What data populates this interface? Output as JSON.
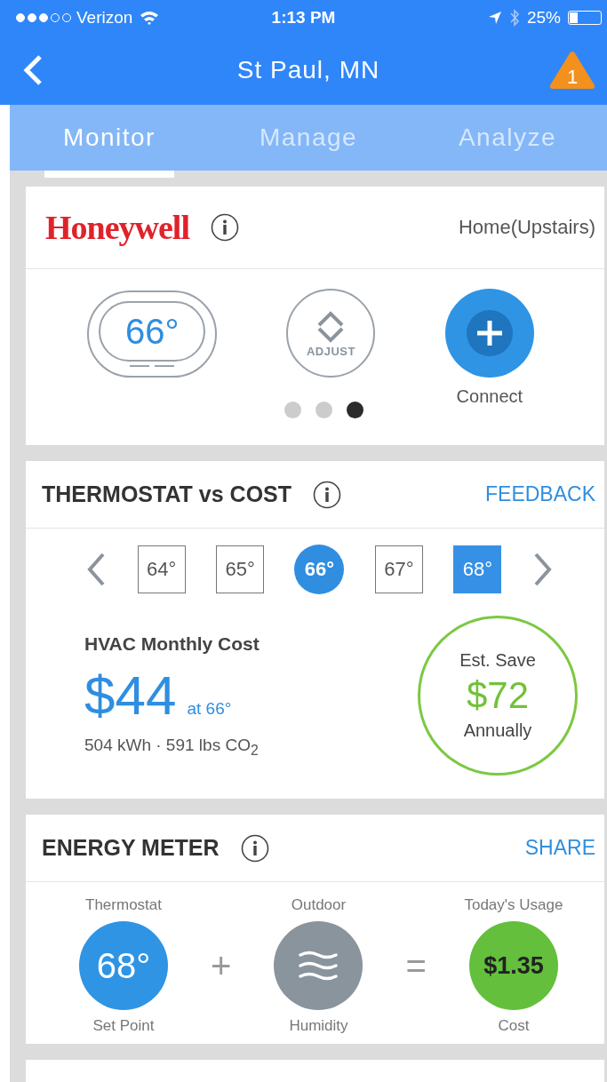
{
  "status_bar": {
    "carrier": "Verizon",
    "time": "1:13 PM",
    "battery": "25%"
  },
  "nav": {
    "title": "St Paul, MN",
    "alert_count": "1"
  },
  "tabs": [
    {
      "label": "Monitor",
      "selected": true
    },
    {
      "label": "Manage",
      "selected": false
    },
    {
      "label": "Analyze",
      "selected": false
    }
  ],
  "device_card": {
    "brand": "Honeywell",
    "location": "Home(Upstairs)",
    "temperature": "66°",
    "adjust_label": "ADJUST",
    "connect_label": "Connect",
    "pages": [
      {
        "selected": false
      },
      {
        "selected": false
      },
      {
        "selected": true
      }
    ]
  },
  "cost_card": {
    "title": "THERMOSTAT vs COST",
    "action": "FEEDBACK",
    "temps": [
      {
        "label": "64°",
        "kind": "outline"
      },
      {
        "label": "65°",
        "kind": "outline"
      },
      {
        "label": "66°",
        "kind": "current"
      },
      {
        "label": "67°",
        "kind": "outline"
      },
      {
        "label": "68°",
        "kind": "target"
      }
    ],
    "cost_title": "HVAC Monthly Cost",
    "cost": "$44",
    "cost_at": "at 66°",
    "usage": "504 kWh · 591  lbs CO$_{2}$",
    "save_label": "Est. Save",
    "save_amount": "$72",
    "save_period": "Annually"
  },
  "energy_card": {
    "title": "ENERGY METER",
    "action": "SHARE",
    "items": [
      {
        "top": "Thermostat",
        "value": "68°",
        "bottom": "Set Point",
        "kind": "thermostat"
      },
      {
        "top": "Outdoor",
        "bottom": "Humidity",
        "kind": "humidity"
      },
      {
        "top": "Today's Usage",
        "value": "$1.35",
        "bottom": "Cost",
        "kind": "cost"
      }
    ],
    "operators": [
      "+",
      "="
    ]
  }
}
